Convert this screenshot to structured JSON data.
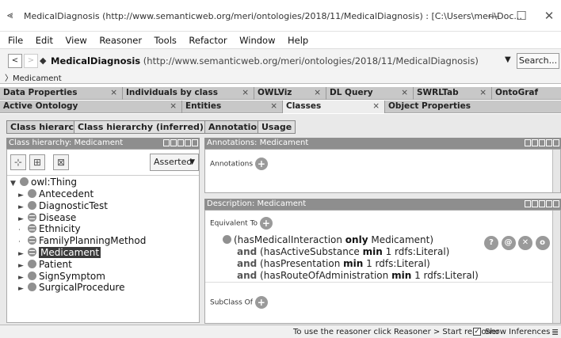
{
  "window": {
    "title": "MedicalDiagnosis (http://www.semanticweb.org/meri/ontologies/2018/11/MedicalDiagnosis) : [C:\\Users\\meri\\Doc...",
    "minimize": "—",
    "maximize": "☐",
    "close": "✕"
  },
  "menu": [
    "File",
    "Edit",
    "View",
    "Reasoner",
    "Tools",
    "Refactor",
    "Window",
    "Help"
  ],
  "nav": {
    "back": "<",
    "forward": ">",
    "ontology_name": "MedicalDiagnosis",
    "ontology_iri": "(http://www.semanticweb.org/meri/ontologies/2018/11/MedicalDiagnosis)",
    "search": "Search...",
    "breadcrumb": "Medicament"
  },
  "tabs_row1": [
    {
      "label": "Data Properties"
    },
    {
      "label": "Individuals by class"
    },
    {
      "label": "OWLViz"
    },
    {
      "label": "DL Query"
    },
    {
      "label": "SWRLTab"
    },
    {
      "label": "OntoGraf"
    }
  ],
  "tabs_row2": [
    {
      "label": "Active Ontology"
    },
    {
      "label": "Entities"
    },
    {
      "label": "Classes"
    },
    {
      "label": "Object Properties"
    }
  ],
  "left": {
    "subtabs": [
      "Class hierarchy",
      "Class hierarchy (inferred)"
    ],
    "header": "Class hierarchy: Medicament",
    "asserted": "Asserted",
    "root": "owl:Thing",
    "classes": [
      {
        "label": "Antecedent",
        "expand": true,
        "eq": false
      },
      {
        "label": "DiagnosticTest",
        "expand": true,
        "eq": false
      },
      {
        "label": "Disease",
        "expand": true,
        "eq": true
      },
      {
        "label": "Ethnicity",
        "expand": false,
        "eq": true
      },
      {
        "label": "FamilyPlanningMethod",
        "expand": false,
        "eq": true
      },
      {
        "label": "Medicament",
        "expand": true,
        "eq": true,
        "selected": true
      },
      {
        "label": "Patient",
        "expand": true,
        "eq": false
      },
      {
        "label": "SignSymptom",
        "expand": true,
        "eq": false
      },
      {
        "label": "SurgicalProcedure",
        "expand": true,
        "eq": false
      }
    ]
  },
  "right": {
    "subtabs": [
      "Annotations",
      "Usage"
    ],
    "annotations_header": "Annotations: Medicament",
    "annotations_label": "Annotations",
    "description_header": "Description: Medicament",
    "equivalent_label": "Equivalent To",
    "subclass_label": "SubClass Of",
    "expr": {
      "line1_pre": "(hasMedicalInteraction ",
      "line1_kw": "only",
      "line1_post": " Medicament)",
      "and": "and",
      "lines": [
        {
          "pre": " (hasActiveSubstance ",
          "kw": "min",
          "post": " 1 rdfs:Literal)"
        },
        {
          "pre": " (hasPresentation ",
          "kw": "min",
          "post": " 1 rdfs:Literal)"
        },
        {
          "pre": " (hasRouteOfAdministration ",
          "kw": "min",
          "post": " 1 rdfs:Literal)"
        }
      ]
    },
    "row_buttons": [
      "?",
      "@",
      "✕",
      "o"
    ]
  },
  "status": {
    "message": "To use the reasoner click Reasoner > Start reasoner",
    "show_inferences": "Show Inferences"
  }
}
